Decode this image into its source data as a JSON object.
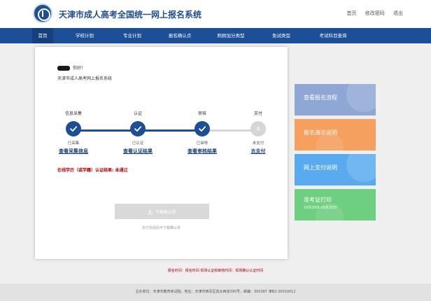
{
  "header": {
    "title": "天津市成人高考全国统一网上报名系统",
    "links": [
      "首页",
      "修改密码",
      "退出"
    ]
  },
  "nav": {
    "items": [
      "首页",
      "学校计划",
      "专业计划",
      "报名确认点",
      "照顾加分类型",
      "免试类型",
      "考试科目查询"
    ]
  },
  "main": {
    "greeting": "你好！",
    "welcome": "天津市成人高考网上报名系统",
    "steps": [
      {
        "title": "信息采集",
        "status": "已采集",
        "link": "查看采集信息",
        "state": "done",
        "number": ""
      },
      {
        "title": "认证",
        "status": "已认证",
        "link": "查看认证结果",
        "state": "done",
        "number": ""
      },
      {
        "title": "审核",
        "status": "已审核",
        "link": "查看审核结果",
        "state": "done",
        "number": ""
      },
      {
        "title": "支付",
        "status": "未支付",
        "link": "去支付",
        "state": "todo",
        "number": "4"
      }
    ],
    "auth_result": "在线学历（或学籍）认证结果: 未通过",
    "download_button": "下载确认单",
    "download_hint": "支付完成后可下载确认单"
  },
  "tiles": [
    {
      "label": "查看报名流程",
      "sub": "",
      "color": "#8ea7d4"
    },
    {
      "label": "报名演示说明",
      "sub": "",
      "color": "#f5a05f"
    },
    {
      "label": "网上支付说明",
      "sub": "",
      "color": "#5aaaf0"
    },
    {
      "label": "准考证打印",
      "sub": "10月20日-10月25日",
      "color": "#6fcf80"
    }
  ],
  "notice": "报名时间：报名时间 现场认证和审核时间：现场确认认证时间",
  "footer": "主办单位：天津市教育考试院，地址：天津市西青区宾水西道395号，邮编：300387 津B2-20010012",
  "colors": {
    "primary": "#1c4f96",
    "pending": "#d6d6d6",
    "alert": "#b00000"
  }
}
